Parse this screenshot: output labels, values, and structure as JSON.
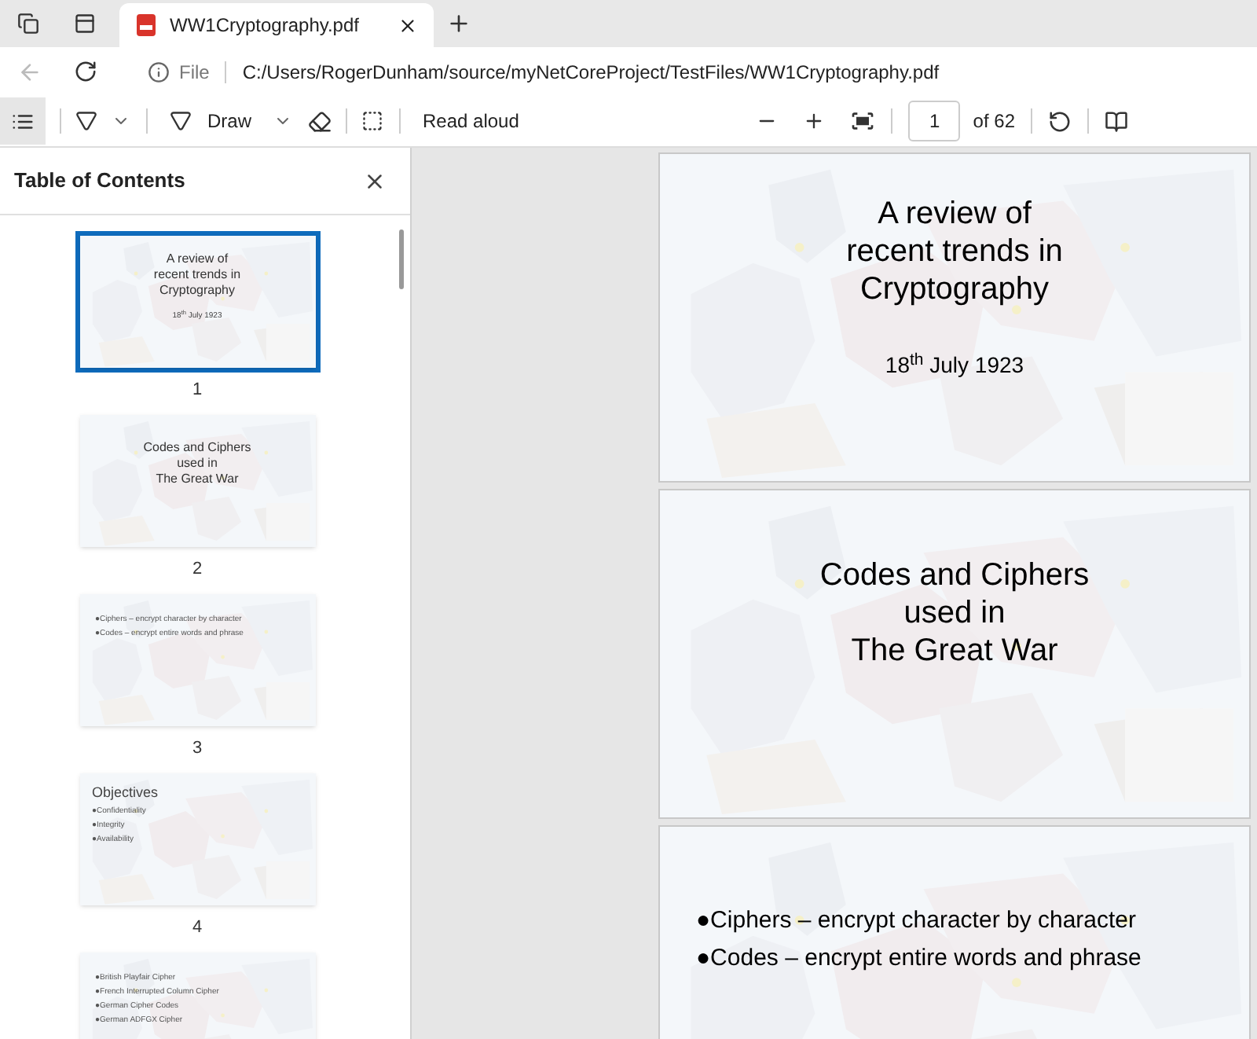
{
  "browser": {
    "tabs": [
      {
        "title": "WW1Cryptography.pdf",
        "selected": true
      }
    ],
    "address": {
      "scheme": "File",
      "url": "C:/Users/RogerDunham/source/myNetCoreProject/TestFiles/WW1Cryptography.pdf"
    }
  },
  "toolbar": {
    "draw_label": "Draw",
    "read_aloud": "Read aloud",
    "page": "1",
    "page_count": "of 62"
  },
  "sidebar": {
    "title": "Table of Contents",
    "thumbnails": [
      {
        "number": "1",
        "selected": true,
        "slide": {
          "kind": "title",
          "lines": [
            "A review of",
            "recent trends in",
            "Cryptography"
          ],
          "date": "18$^{th}$ July 1923"
        }
      },
      {
        "number": "2",
        "selected": false,
        "slide": {
          "kind": "title",
          "lines": [
            "Codes and Ciphers",
            "used in",
            "The Great War"
          ]
        }
      },
      {
        "number": "3",
        "selected": false,
        "slide": {
          "kind": "bullets",
          "bullets": [
            "●Ciphers – encrypt character by character",
            "●Codes –  encrypt entire words and phrase"
          ]
        }
      },
      {
        "number": "4",
        "selected": false,
        "slide": {
          "kind": "bullets",
          "heading": "Objectives",
          "bullets": [
            "●Confidentiality",
            "●Integrity",
            "●Availability"
          ]
        }
      },
      {
        "selected": false,
        "slide": {
          "kind": "bullets",
          "bullets": [
            "●British Playfair Cipher",
            "●French Interrupted Column Cipher",
            "●German Cipher Codes",
            "●German ADFGX Cipher"
          ]
        }
      }
    ]
  },
  "pages": [
    {
      "kind": "title",
      "lines": [
        "A review of",
        "recent trends in",
        "Cryptography"
      ],
      "date": "18$^{th}$ July 1923"
    },
    {
      "kind": "title",
      "lines": [
        "Codes and Ciphers",
        "used in",
        "The Great War"
      ]
    },
    {
      "kind": "bullets",
      "bullets": [
        "●Ciphers – encrypt character by character",
        "●Codes –  encrypt entire words and phrase"
      ]
    }
  ]
}
